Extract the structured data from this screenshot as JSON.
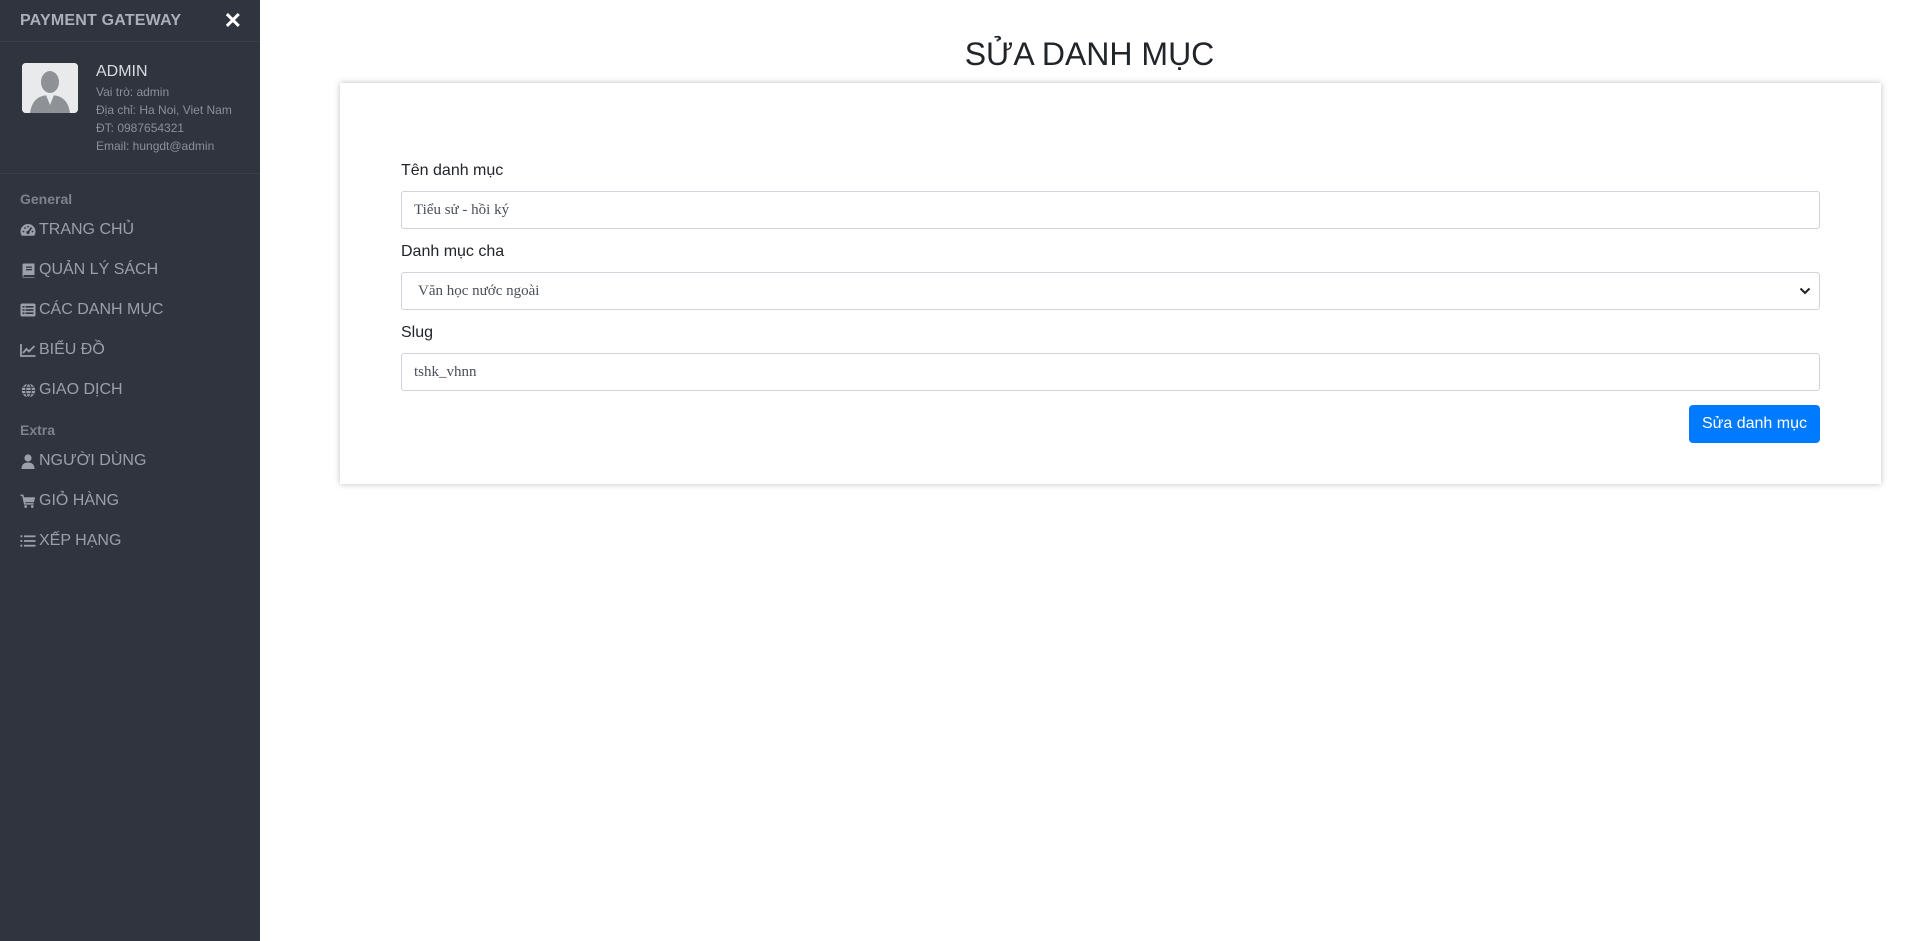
{
  "sidebar": {
    "brand": "PAYMENT GATEWAY",
    "close_glyph": "✕",
    "profile": {
      "name": "ADMIN",
      "role": "Vai trò: admin",
      "address": "Địa chỉ: Ha Noi, Viet Nam",
      "phone": "ĐT: 0987654321",
      "email": "Email: hungdt@admin"
    },
    "general_label": "General",
    "general_items": [
      {
        "label": "TRANG CHỦ",
        "icon": "dashboard-icon"
      },
      {
        "label": "QUẢN LÝ SÁCH",
        "icon": "book-icon"
      },
      {
        "label": "CÁC DANH MỤC",
        "icon": "list-alt-icon"
      },
      {
        "label": "BIỂU ĐỒ",
        "icon": "line-chart-icon"
      },
      {
        "label": "GIAO DỊCH",
        "icon": "globe-icon"
      }
    ],
    "extra_label": "Extra",
    "extra_items": [
      {
        "label": "NGƯỜI DÙNG",
        "icon": "user-icon"
      },
      {
        "label": "GIỎ HÀNG",
        "icon": "cart-icon"
      },
      {
        "label": "XẾP HẠNG",
        "icon": "ordered-list-icon"
      }
    ]
  },
  "main": {
    "title": "SỬA DANH MỤC",
    "form": {
      "name_label": "Tên danh mục",
      "name_value": "Tiểu sử - hồi ký",
      "parent_label": "Danh mục cha",
      "parent_value": "Văn học nước ngoài",
      "slug_label": "Slug",
      "slug_value": "tshk_vhnn",
      "submit_label": "Sửa danh mục"
    }
  },
  "colors": {
    "sidebar_bg": "#2f343e",
    "primary": "#007bff"
  }
}
